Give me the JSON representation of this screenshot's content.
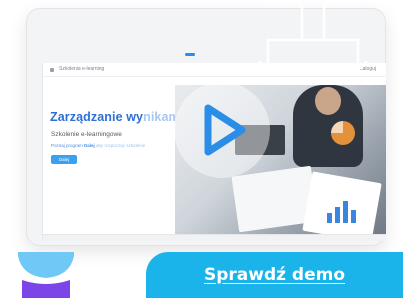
{
  "app": {
    "title": "Zarządzanie wynikami",
    "topbar_title": "Szkolenia e-learning",
    "topbar_link": "Zaloguj"
  },
  "hero": {
    "title_main": "Zarządzanie wy",
    "title_faded": "nikami",
    "subtitle": "Szkolenie e-learningowe",
    "text_main": "Poznaj program ",
    "text_bold": "Dalej",
    "text_faded": " aby rozpocząć szkolenie",
    "button_label": "Dalej"
  },
  "cta": {
    "label": "Sprawdź demo"
  },
  "colors": {
    "accent": "#1ab3ea",
    "play": "#2a8de8",
    "title": "#2c6fd6",
    "deco_light": "#6fc8f5",
    "deco_dark": "#7b45e8"
  },
  "icons": [
    "play-icon",
    "camera-frame-icon"
  ]
}
